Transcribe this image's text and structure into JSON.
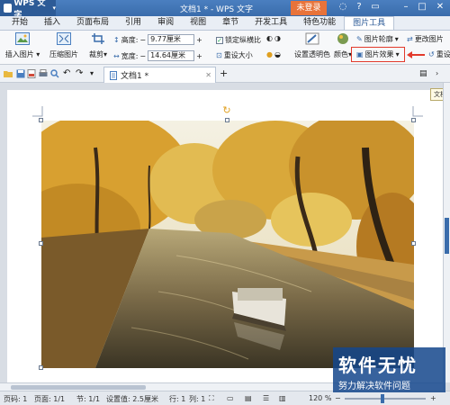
{
  "app": {
    "name": "WPS 文字",
    "title": "文档1 * - WPS 文字",
    "login": "未登录"
  },
  "tabs": [
    "开始",
    "插入",
    "页面布局",
    "引用",
    "审阅",
    "视图",
    "章节",
    "开发工具",
    "特色功能",
    "图片工具"
  ],
  "ribbon": {
    "insert_pic": "插入图片",
    "compress": "压缩图片",
    "crop": "裁剪",
    "height_label": "高度:",
    "height_value": "9.77厘米",
    "width_label": "宽度:",
    "width_value": "14.64厘米",
    "lock_ratio": "锁定纵横比",
    "reset_size": "重设大小",
    "set_transparent": "设置透明色",
    "color": "颜色",
    "pic_outline": "图片轮廓",
    "pic_effects": "图片效果",
    "change_pic": "更改图片",
    "reset_pic": "重设图片"
  },
  "doc_tab": {
    "name": "文档1 *"
  },
  "tooltip": "文档",
  "status": {
    "page_num": "页码: 1",
    "pages": "页面: 1/1",
    "section": "节: 1/1",
    "setting": "设置值: 2.5厘米",
    "row": "行: 1",
    "col": "列: 1",
    "zoom": "120 %"
  },
  "watermark": {
    "title": "软件无忧",
    "subtitle": "努力解决软件问题"
  },
  "colors": {
    "title_bar": "#3a6cab",
    "login": "#e8733a",
    "highlight": "#e23a2c"
  }
}
